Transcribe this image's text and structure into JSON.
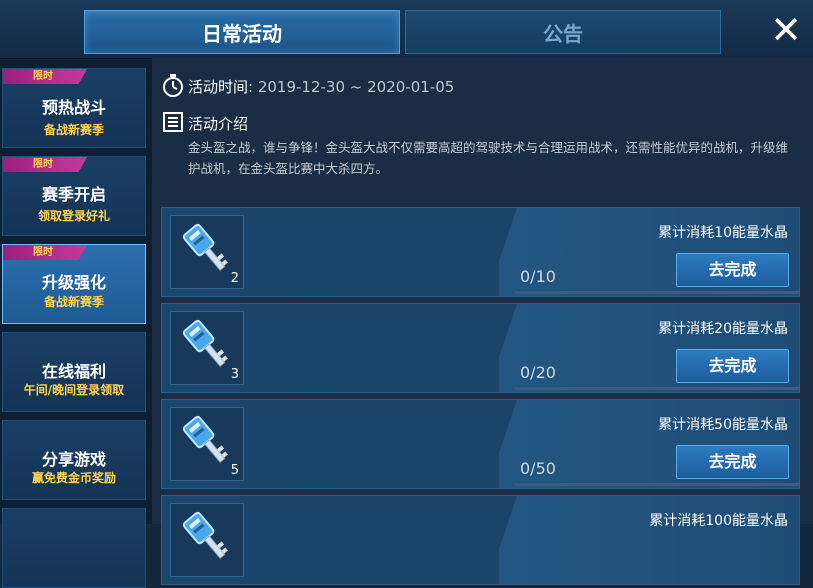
{
  "tabs": {
    "active": "日常活动",
    "inactive": "公告"
  },
  "close_symbol": "✕",
  "sidebar": [
    {
      "tag": "限时",
      "title": "预热战斗",
      "subtitle": "备战新赛季",
      "active": false
    },
    {
      "tag": "限时",
      "title": "赛季开启",
      "subtitle": "领取登录好礼",
      "active": false
    },
    {
      "tag": "限时",
      "title": "升级强化",
      "subtitle": "备战新赛季",
      "active": true
    },
    {
      "tag": "",
      "title": "在线福利",
      "subtitle": "午间/晚间登录领取",
      "active": false
    },
    {
      "tag": "",
      "title": "分享游戏",
      "subtitle": "赢免费金币奖励",
      "active": false
    }
  ],
  "activity": {
    "time_label": "活动时间:",
    "time_value": "2019-12-30 ~ 2020-01-05",
    "intro_label": "活动介绍",
    "description": "金头盔之战，谁与争锋！金头盔大战不仅需要高超的驾驶技术与合理运用战术，还需性能优异的战机，升级维护战机，在金头盔比赛中大杀四方。"
  },
  "tasks": [
    {
      "title": "累计消耗10能量水晶",
      "progress": "0/10",
      "fill": 0,
      "reward_count": "2",
      "button": "去完成"
    },
    {
      "title": "累计消耗20能量水晶",
      "progress": "0/20",
      "fill": 0,
      "reward_count": "3",
      "button": "去完成"
    },
    {
      "title": "累计消耗50能量水晶",
      "progress": "0/50",
      "fill": 0,
      "reward_count": "5",
      "button": "去完成"
    },
    {
      "title": "累计消耗100能量水晶",
      "progress": "",
      "fill": 0,
      "reward_count": "",
      "button": ""
    }
  ],
  "icons": {
    "clock": "stopwatch-icon",
    "intro": "list-icon",
    "reward": "key-icon"
  },
  "colors": {
    "accent": "#2e7bc1",
    "subtitle": "#ffd24a",
    "tag": "#c23a9c"
  }
}
